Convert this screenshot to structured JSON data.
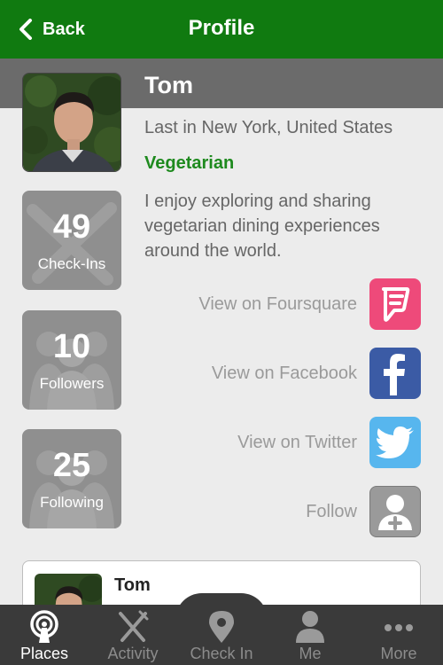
{
  "navbar": {
    "back_label": "Back",
    "title": "Profile"
  },
  "profile": {
    "name": "Tom",
    "location": "Last in New York, United States",
    "diet": "Vegetarian",
    "bio": "I enjoy exploring and sharing vegetarian dining experiences around the world."
  },
  "stats": [
    {
      "value": "49",
      "label": "Check-Ins"
    },
    {
      "value": "10",
      "label": "Followers"
    },
    {
      "value": "25",
      "label": "Following"
    }
  ],
  "links": [
    {
      "label": "View on Foursquare",
      "icon": "foursquare-icon",
      "color": "#ee4a7a"
    },
    {
      "label": "View on Facebook",
      "icon": "facebook-icon",
      "color": "#3b5ba5"
    },
    {
      "label": "View on Twitter",
      "icon": "twitter-icon",
      "color": "#57b6ee"
    },
    {
      "label": "Follow",
      "icon": "add-user-icon",
      "color": "#9a9a9a"
    }
  ],
  "card": {
    "name": "Tom"
  },
  "tabs": [
    {
      "label": "Places",
      "icon": "places-icon"
    },
    {
      "label": "Activity",
      "icon": "fork-knife-icon"
    },
    {
      "label": "Check In",
      "icon": "location-pin-icon"
    },
    {
      "label": "Me",
      "icon": "person-icon"
    },
    {
      "label": "More",
      "icon": "more-dots-icon"
    }
  ],
  "colors": {
    "navbar": "#107a10",
    "accent": "#1e8a1e",
    "tabbar": "#3a3a3a"
  }
}
